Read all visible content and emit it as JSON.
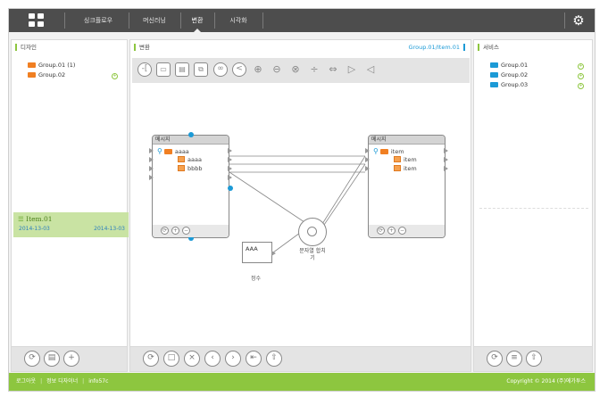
{
  "topbar": {
    "menus": [
      "싱크플로우",
      "머신러닝",
      "변환",
      "시각화"
    ],
    "active_menu": "변환"
  },
  "left_panel": {
    "title": "디자인",
    "groups": [
      {
        "label": "Group.01 (1)",
        "folder_color": "#f07f22"
      },
      {
        "label": "Group.02",
        "folder_color": "#f07f22"
      }
    ],
    "selected_item": {
      "name": "Item.01",
      "created": "2014-13-03",
      "modified": "2014-13-03"
    }
  },
  "center_panel": {
    "title": "변환",
    "path": "Group.01/Item.01",
    "nodes": {
      "left": {
        "title": "메시지",
        "rows": [
          "aaaa",
          "aaaa",
          "bbbb"
        ]
      },
      "right": {
        "title": "메시지",
        "rows": [
          "item",
          "item",
          "item"
        ]
      },
      "constant": {
        "value": "AAA",
        "label": "정수"
      },
      "function": {
        "label_line1": "문자열 합치",
        "label_line2": "기"
      }
    }
  },
  "right_panel": {
    "title": "서비스",
    "groups": [
      {
        "label": "Group.01",
        "folder_color": "#1c9ad6"
      },
      {
        "label": "Group.02",
        "folder_color": "#1c9ad6"
      },
      {
        "label": "Group.03",
        "folder_color": "#1c9ad6"
      }
    ]
  },
  "footer": {
    "logout": "로그아웃",
    "info_designer": "정보 디자이너",
    "user": "info57c",
    "copyright": "Copyright © 2014 (주)에가투스"
  },
  "colors": {
    "accent_green": "#8dc63f",
    "accent_blue": "#1c9ad6",
    "folder_orange": "#f07f22",
    "topbar": "#4d4d4d"
  }
}
